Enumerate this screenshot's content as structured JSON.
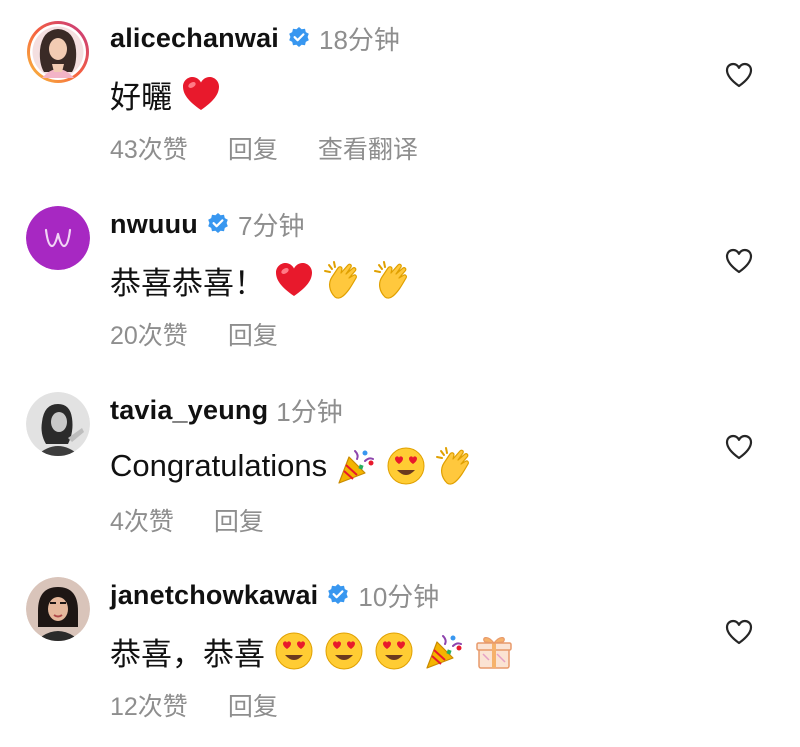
{
  "comments": [
    {
      "username": "alicechanwai",
      "verified": true,
      "time": "18分钟",
      "text": "好曬",
      "emojis": [
        "red-heart"
      ],
      "likes": "43次赞",
      "reply": "回复",
      "translate": "查看翻译",
      "avatar_icon": "woman-portrait-avatar",
      "has_story_ring": true
    },
    {
      "username": "nwuuu",
      "verified": true,
      "time": "7分钟",
      "text": "恭喜恭喜！",
      "emojis": [
        "red-heart",
        "clapping-hands",
        "clapping-hands"
      ],
      "likes": "20次赞",
      "reply": "回复",
      "avatar_icon": "purple-w-logo-avatar"
    },
    {
      "username": "tavia_yeung",
      "verified": false,
      "time": "1分钟",
      "text": "Congratulations",
      "emojis": [
        "party-popper",
        "heart-eyes-face",
        "clapping-hands"
      ],
      "likes": "4次赞",
      "reply": "回复",
      "avatar_icon": "grayscale-portrait-avatar"
    },
    {
      "username": "janetchowkawai",
      "verified": true,
      "time": "10分钟",
      "text": "恭喜，恭喜",
      "emojis": [
        "heart-eyes-face",
        "heart-eyes-face",
        "heart-eyes-face",
        "party-popper",
        "wrapped-gift"
      ],
      "likes": "12次赞",
      "reply": "回复",
      "avatar_icon": "woman-portrait-avatar"
    }
  ],
  "colors": {
    "text": "#111111",
    "secondary_text": "#8e8e8e",
    "verified_blue": "#3897f0",
    "heart_red": "#e8192c",
    "avatar_purple": "#a728c2"
  }
}
